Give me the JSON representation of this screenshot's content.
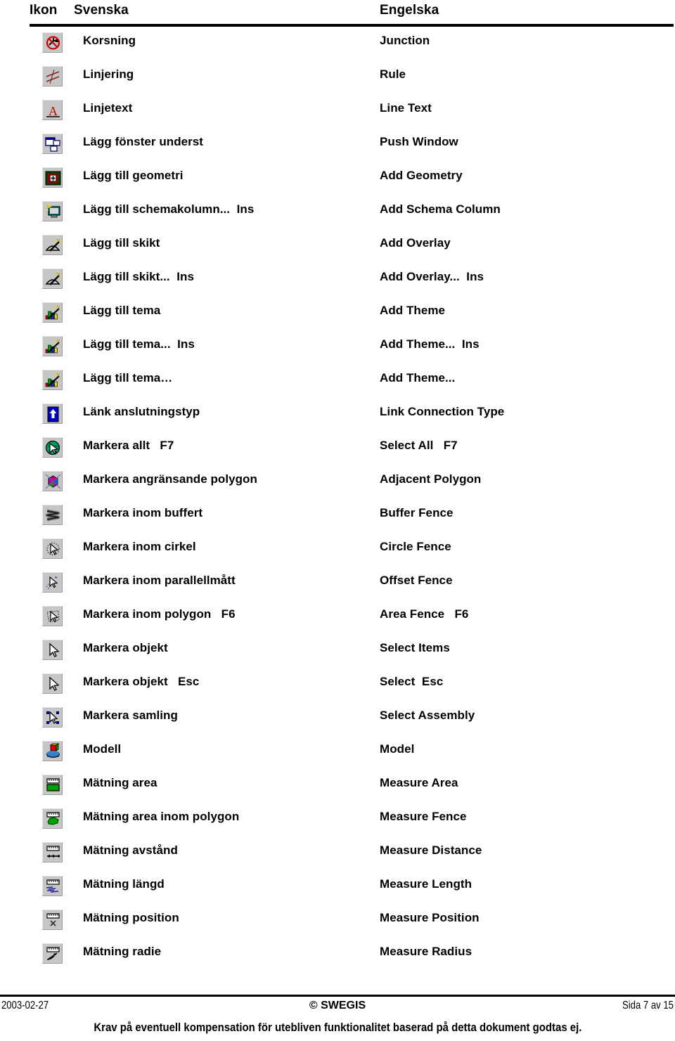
{
  "header": {
    "col_icon": "Ikon",
    "col_swedish": "Svenska",
    "col_english": "Engelska"
  },
  "rows": [
    {
      "icon": "no-junction-icon",
      "swedish": "Korsning",
      "english": "Junction"
    },
    {
      "icon": "rule-lines-icon",
      "swedish": "Linjering",
      "english": "Rule"
    },
    {
      "icon": "line-text-icon",
      "swedish": "Linjetext",
      "english": "Line Text"
    },
    {
      "icon": "push-window-icon",
      "swedish": "Lägg fönster underst",
      "english": "Push Window"
    },
    {
      "icon": "add-geometry-icon",
      "swedish": "Lägg till geometri",
      "english": "Add Geometry"
    },
    {
      "icon": "add-schema-column-icon",
      "swedish": "Lägg till schemakolumn...  Ins",
      "english": "Add Schema Column"
    },
    {
      "icon": "add-overlay-icon",
      "swedish": "Lägg till skikt",
      "english": "Add Overlay"
    },
    {
      "icon": "add-overlay-ins-icon",
      "swedish": "Lägg till skikt...  Ins",
      "english": "Add Overlay...  Ins"
    },
    {
      "icon": "add-theme-icon",
      "swedish": "Lägg till tema",
      "english": "Add Theme"
    },
    {
      "icon": "add-theme-ins-icon",
      "swedish": "Lägg till tema...  Ins",
      "english": "Add Theme...  Ins"
    },
    {
      "icon": "add-theme-dots-icon",
      "swedish": "Lägg till tema…",
      "english": "Add Theme..."
    },
    {
      "icon": "link-connection-icon",
      "swedish": "Länk anslutningstyp",
      "english": "Link Connection Type"
    },
    {
      "icon": "select-all-icon",
      "swedish": "Markera allt   F7",
      "english": "Select All   F7"
    },
    {
      "icon": "adjacent-polygon-icon",
      "swedish": "Markera angränsande polygon",
      "english": "Adjacent Polygon"
    },
    {
      "icon": "buffer-fence-icon",
      "swedish": "Markera inom buffert",
      "english": "Buffer Fence"
    },
    {
      "icon": "circle-fence-icon",
      "swedish": "Markera inom cirkel",
      "english": "Circle Fence"
    },
    {
      "icon": "offset-fence-icon",
      "swedish": "Markera inom parallellmått",
      "english": "Offset Fence"
    },
    {
      "icon": "area-fence-icon",
      "swedish": "Markera inom polygon   F6",
      "english": "Area Fence   F6"
    },
    {
      "icon": "select-items-icon",
      "swedish": "Markera objekt",
      "english": "Select Items"
    },
    {
      "icon": "select-esc-icon",
      "swedish": "Markera objekt   Esc",
      "english": "Select  Esc"
    },
    {
      "icon": "select-assembly-icon",
      "swedish": "Markera samling",
      "english": "Select Assembly"
    },
    {
      "icon": "model-icon",
      "swedish": "Modell",
      "english": "Model"
    },
    {
      "icon": "measure-area-icon",
      "swedish": "Mätning area",
      "english": "Measure Area"
    },
    {
      "icon": "measure-fence-icon",
      "swedish": "Mätning area inom polygon",
      "english": "Measure Fence"
    },
    {
      "icon": "measure-distance-icon",
      "swedish": "Mätning avstånd",
      "english": "Measure Distance"
    },
    {
      "icon": "measure-length-icon",
      "swedish": "Mätning längd",
      "english": "Measure Length"
    },
    {
      "icon": "measure-position-icon",
      "swedish": "Mätning position",
      "english": "Measure Position"
    },
    {
      "icon": "measure-radius-icon",
      "swedish": "Mätning radie",
      "english": "Measure Radius"
    }
  ],
  "footer": {
    "date": "2003-02-27",
    "copyright": "© SWEGIS",
    "page": "Sida 7 av 15",
    "notice": "Krav på eventuell kompensation för utebliven funktionalitet baserad på detta dokument godtas ej."
  },
  "colors": {
    "ink": "#000000",
    "button_face": "#c6c6c6",
    "red": "#cc0000",
    "blue": "#0000aa",
    "green": "#008000"
  }
}
